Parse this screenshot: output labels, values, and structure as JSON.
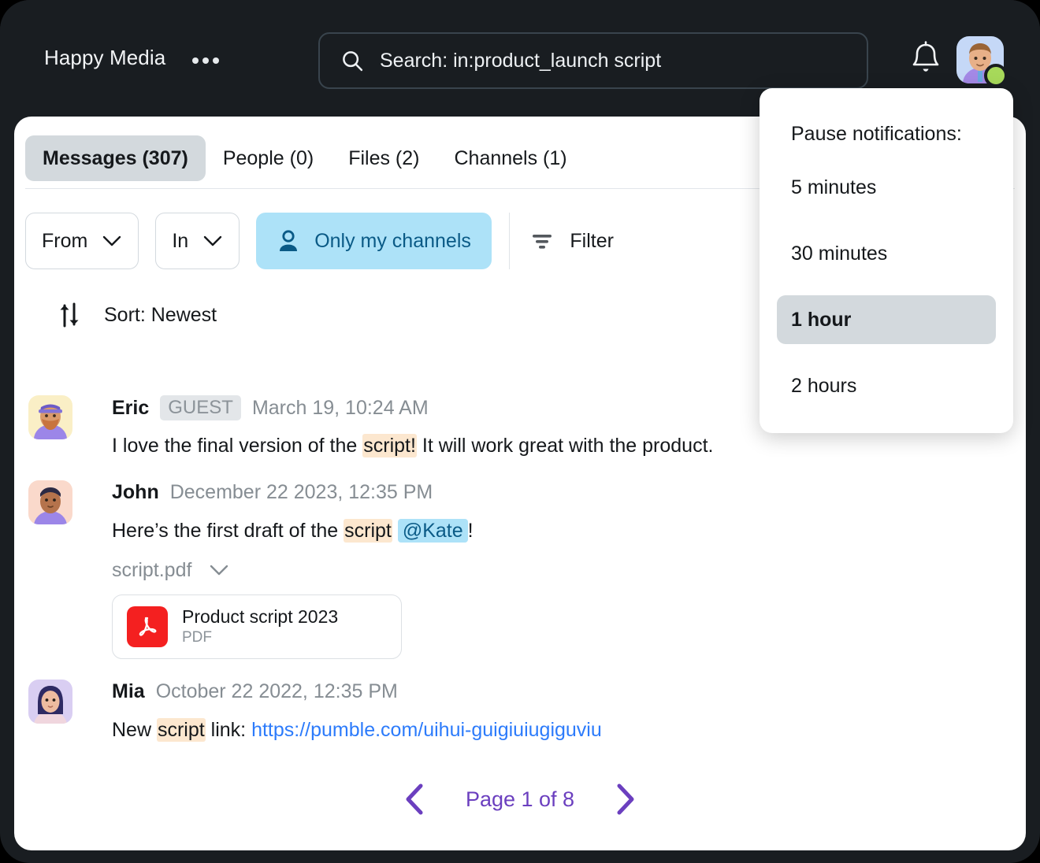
{
  "header": {
    "workspace_name": "Happy Media",
    "menu_icon": "ellipsis-icon",
    "search_value": "Search: in:product_launch script",
    "search_icon": "search-icon",
    "bell_icon": "bell-icon",
    "avatar_icon": "user-avatar",
    "status": "online"
  },
  "tabs": [
    {
      "label": "Messages (307)",
      "active": true
    },
    {
      "label": "People (0)",
      "active": false
    },
    {
      "label": "Files (2)",
      "active": false
    },
    {
      "label": "Channels (1)",
      "active": false
    }
  ],
  "filters": {
    "from_label": "From",
    "in_label": "In",
    "only_my_channels_label": "Only my channels",
    "filter_label": "Filter",
    "sort_label": "Sort: Newest"
  },
  "messages": [
    {
      "author": "Eric",
      "badge": "GUEST",
      "time": "March 19, 10:24 AM",
      "text_before": "I love the final version of the ",
      "highlight": "script!",
      "text_after": " It will work great with the product."
    },
    {
      "author": "John",
      "time": "December 22 2023, 12:35 PM",
      "text_before": "Here’s the first draft of the ",
      "highlight": "script",
      "mention": "@Kate",
      "text_after": "!",
      "attachment_name": "script.pdf",
      "attachment_title": "Product script 2023",
      "attachment_type": "PDF"
    },
    {
      "author": "Mia",
      "time": "October 22 2022, 12:35 PM",
      "text_before": "New ",
      "highlight": "script",
      "text_after": " link: ",
      "link": "https://pumble.com/uihui-guigiuiugiguviu"
    }
  ],
  "pagination": {
    "prev_icon": "chevron-left-icon",
    "label": "Page 1 of 8",
    "next_icon": "chevron-right-icon"
  },
  "notification_dropdown": {
    "title": "Pause notifications:",
    "options": [
      {
        "label": "5 minutes",
        "selected": false
      },
      {
        "label": "30 minutes",
        "selected": false
      },
      {
        "label": "1 hour",
        "selected": true
      },
      {
        "label": "2 hours",
        "selected": false
      }
    ]
  },
  "colors": {
    "window_bg": "#191D21",
    "accent_purple": "#6B3FBF",
    "pill_blue": "#ADE2F8",
    "pill_blue_text": "#0A5A86",
    "highlight_orange": "#FCE7CF",
    "link_blue": "#2C7BFB",
    "status_green": "#A7D95A",
    "pdf_red": "#F42020",
    "active_tab_gray": "#D3D9DD"
  }
}
